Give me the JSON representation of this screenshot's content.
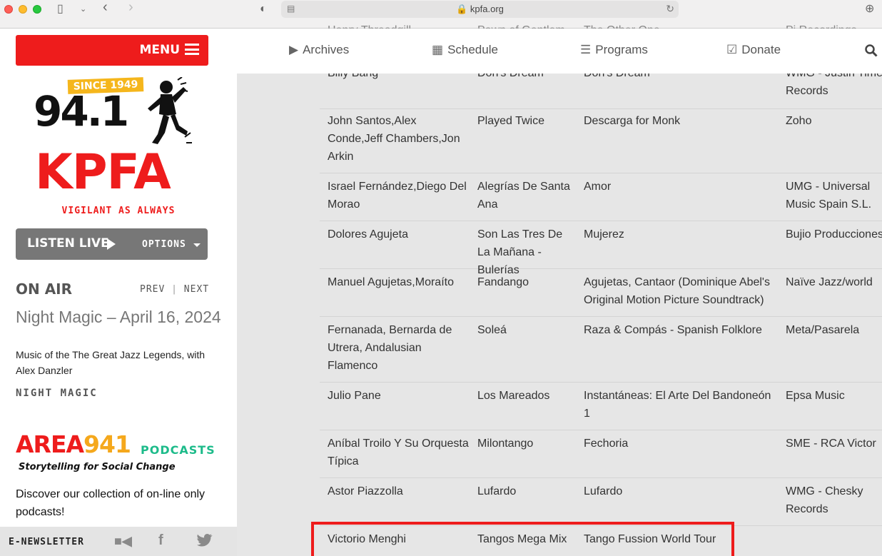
{
  "browser": {
    "url": "kpfa.org"
  },
  "sidebar": {
    "menu_label": "MENU",
    "logo": {
      "since": "SINCE 1949",
      "frequency": "94.1",
      "callsign": "KPFA",
      "tagline": "VIGILANT AS ALWAYS"
    },
    "listen_live": "LISTEN LIVE",
    "options": "OPTIONS",
    "on_air": "ON AIR",
    "prev": "PREV",
    "next": "NEXT",
    "show_title": "Night Magic – April 16, 2024",
    "show_desc": "Music of the The Great Jazz Legends, with Alex Danzler",
    "show_tag": "NIGHT MAGIC",
    "area941": {
      "a1": "AREA",
      "a2": "941",
      "podcasts": "PODCASTS",
      "tagline": "Storytelling for Social Change"
    },
    "discover": "Discover our collection of on-line only podcasts!",
    "footer": {
      "enews": "E-NEWSLETTER"
    }
  },
  "nav": {
    "archives": "Archives",
    "schedule": "Schedule",
    "programs": "Programs",
    "donate": "Donate"
  },
  "partial_row": [
    "Henry Threadgill",
    "Pawn of Gentlem",
    "The Other One",
    "Pi Recordings"
  ],
  "rows": [
    [
      "Billy Bang",
      "Don's Dream",
      "Don's Dream",
      "WMG - Justin Time Records"
    ],
    [
      "John Santos,Alex Conde,Jeff Chambers,Jon Arkin",
      "Played Twice",
      "Descarga for Monk",
      "Zoho"
    ],
    [
      "Israel Fernández,Diego Del Morao",
      "Alegrías De Santa Ana",
      "Amor",
      "UMG - Universal Music Spain S.L."
    ],
    [
      "Dolores Agujeta",
      "Son Las Tres De La Mañana - Bulerías",
      "Mujerez",
      "Bujio Producciones"
    ],
    [
      "Manuel Agujetas,Moraíto",
      "Fandango",
      "Agujetas, Cantaor (Dominique Abel's Original Motion Picture Soundtrack)",
      "Naïve Jazz/world"
    ],
    [
      "Fernanada, Bernarda de Utrera, Andalusian Flamenco",
      "Soleá",
      "Raza & Compás - Spanish Folklore",
      "Meta/Pasarela"
    ],
    [
      "Julio Pane",
      "Los Mareados",
      "Instantáneas: El Arte Del Bandoneón 1",
      "Epsa Music"
    ],
    [
      "Aníbal Troilo Y Su Orquesta Típica",
      "Milontango",
      "Fechoria",
      "SME - RCA Victor"
    ],
    [
      "Astor Piazzolla",
      "Lufardo",
      "Lufardo",
      "WMG - Chesky Records"
    ],
    [
      "Victorio Menghi",
      "Tangos Mega Mix",
      "Tango Fussion World Tour",
      ""
    ]
  ]
}
